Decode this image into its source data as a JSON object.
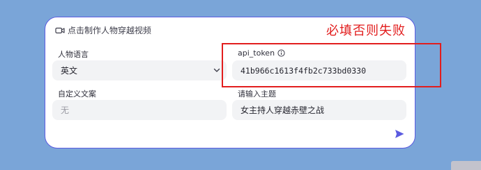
{
  "header": {
    "title": "点击制作人物穿越视频",
    "icon": "video-camera-icon"
  },
  "form": {
    "language": {
      "label": "人物语言",
      "value": "英文"
    },
    "api_token": {
      "label": "api_token",
      "value": "41b966c1613f4fb2c733bd0330"
    },
    "custom_copy": {
      "label": "自定义文案",
      "value": "无"
    },
    "topic": {
      "label": "请输入主题",
      "value": "女主持人穿越赤壁之战"
    }
  },
  "annotation": {
    "text": "必填否则失败",
    "color": "#e21d1d"
  },
  "colors": {
    "accent": "#5b5be0",
    "background": "#7aa5d8",
    "field_bg": "#f2f3f5"
  }
}
